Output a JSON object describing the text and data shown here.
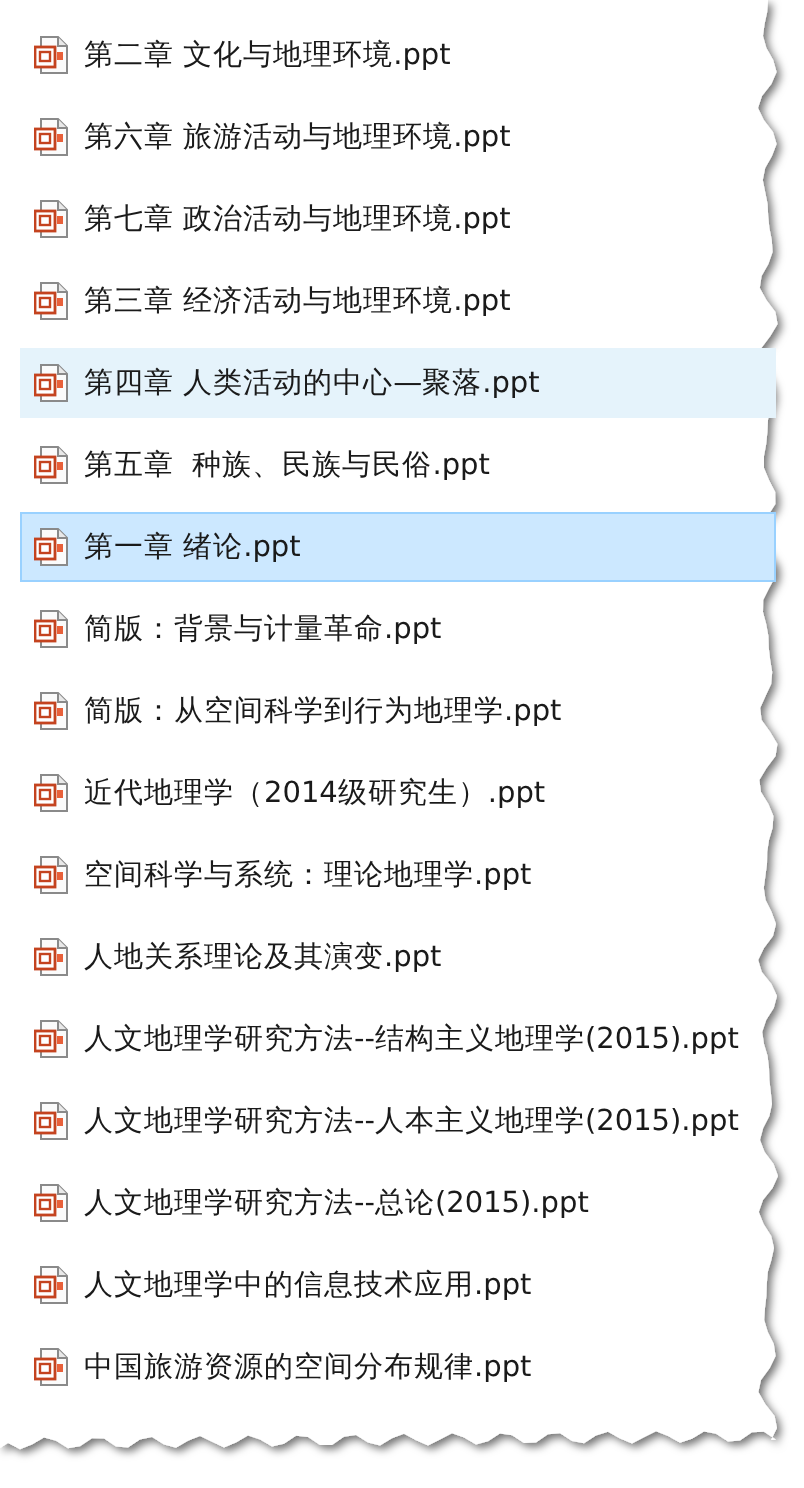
{
  "files": [
    {
      "name": "第二章 文化与地理环境.ppt",
      "selected": false,
      "hovered": false
    },
    {
      "name": "第六章 旅游活动与地理环境.ppt",
      "selected": false,
      "hovered": false
    },
    {
      "name": "第七章 政治活动与地理环境.ppt",
      "selected": false,
      "hovered": false
    },
    {
      "name": "第三章 经济活动与地理环境.ppt",
      "selected": false,
      "hovered": false
    },
    {
      "name": "第四章 人类活动的中心—聚落.ppt",
      "selected": false,
      "hovered": true
    },
    {
      "name": "第五章  种族、民族与民俗.ppt",
      "selected": false,
      "hovered": false
    },
    {
      "name": "第一章 绪论.ppt",
      "selected": true,
      "hovered": false
    },
    {
      "name": "简版：背景与计量革命.ppt",
      "selected": false,
      "hovered": false
    },
    {
      "name": "简版：从空间科学到行为地理学.ppt",
      "selected": false,
      "hovered": false
    },
    {
      "name": "近代地理学（2014级研究生）.ppt",
      "selected": false,
      "hovered": false
    },
    {
      "name": "空间科学与系统：理论地理学.ppt",
      "selected": false,
      "hovered": false
    },
    {
      "name": "人地关系理论及其演变.ppt",
      "selected": false,
      "hovered": false
    },
    {
      "name": "人文地理学研究方法--结构主义地理学(2015).ppt",
      "selected": false,
      "hovered": false
    },
    {
      "name": "人文地理学研究方法--人本主义地理学(2015).ppt",
      "selected": false,
      "hovered": false
    },
    {
      "name": "人文地理学研究方法--总论(2015).ppt",
      "selected": false,
      "hovered": false
    },
    {
      "name": "人文地理学中的信息技术应用.ppt",
      "selected": false,
      "hovered": false
    },
    {
      "name": "中国旅游资源的空间分布规律.ppt",
      "selected": false,
      "hovered": false
    }
  ]
}
